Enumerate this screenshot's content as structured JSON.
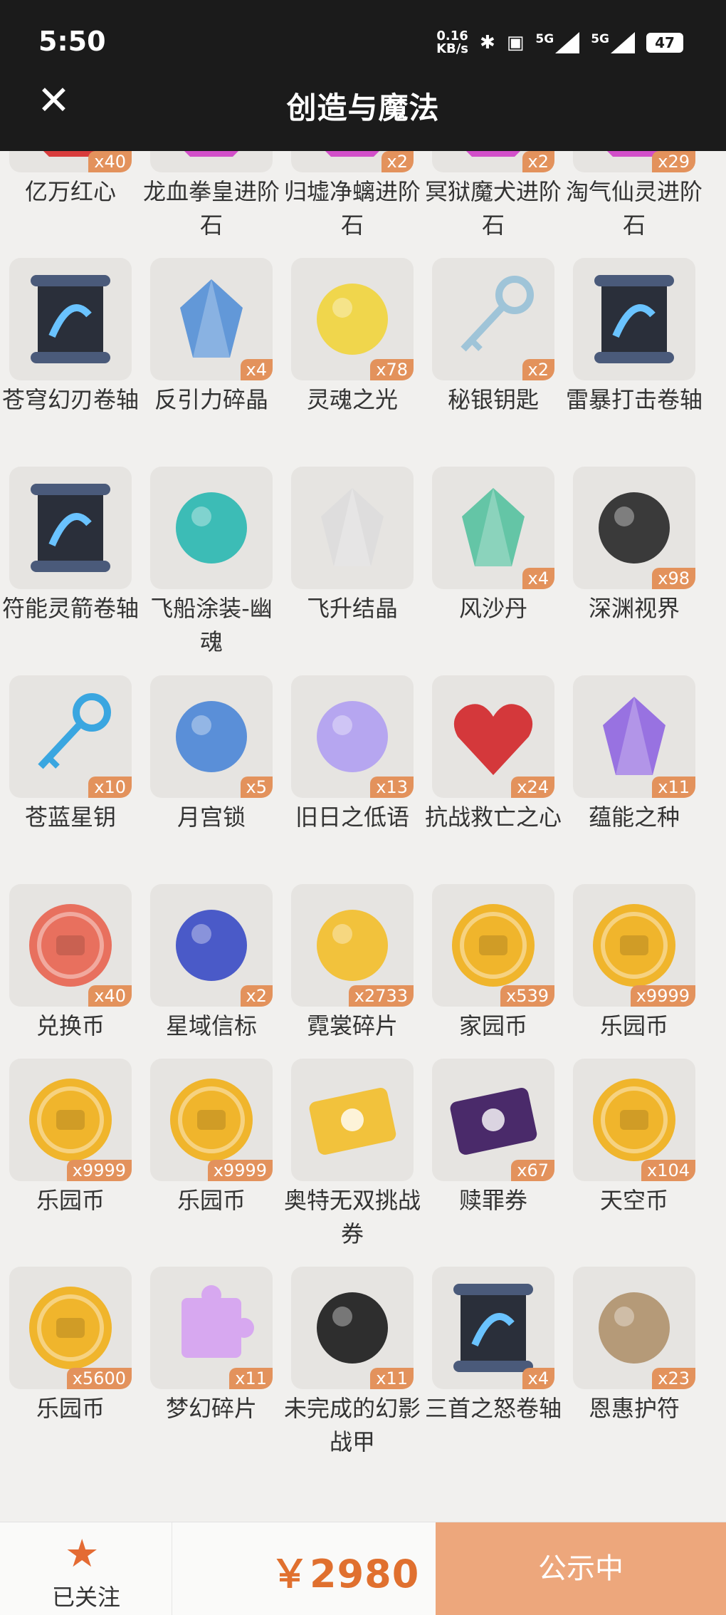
{
  "status_bar": {
    "time": "5:50",
    "speed_value": "0.16",
    "speed_unit": "KB/s",
    "network_1": "5G",
    "network_2": "5G",
    "battery": "47"
  },
  "header": {
    "title": "创造与魔法",
    "close_icon": "close-icon"
  },
  "items": [
    {
      "name": "亿万红心",
      "count": "x40",
      "icon": "heart-gem-icon",
      "color": "#d83c3c"
    },
    {
      "name": "龙血拳皇进阶石",
      "count": "",
      "icon": "bull-emblem-gem-icon",
      "color": "#d24fc9"
    },
    {
      "name": "归墟净螭进阶石",
      "count": "x2",
      "icon": "dragon-emblem-gem-icon",
      "color": "#d24fc9"
    },
    {
      "name": "冥狱魔犬进阶石",
      "count": "x2",
      "icon": "serpent-emblem-gem-icon",
      "color": "#d24fc9"
    },
    {
      "name": "淘气仙灵进阶石",
      "count": "x29",
      "icon": "fairy-emblem-gem-icon",
      "color": "#d24fc9"
    },
    {
      "name": "苍穹幻刃卷轴",
      "count": "",
      "icon": "scroll-icon",
      "color": "#2a2f3a"
    },
    {
      "name": "反引力碎晶",
      "count": "x4",
      "icon": "crystal-shards-icon",
      "color": "#4a8bd6"
    },
    {
      "name": "灵魂之光",
      "count": "x78",
      "icon": "soul-light-icon",
      "color": "#f0d64c"
    },
    {
      "name": "秘银钥匙",
      "count": "x2",
      "icon": "silver-key-icon",
      "color": "#9fc4d8"
    },
    {
      "name": "雷暴打击卷轴",
      "count": "",
      "icon": "scroll-icon",
      "color": "#2a2f3a"
    },
    {
      "name": "符能灵箭卷轴",
      "count": "",
      "icon": "scroll-icon",
      "color": "#2a2f3a"
    },
    {
      "name": "飞船涂装-幽魂",
      "count": "",
      "icon": "paint-spray-icon",
      "color": "#3cbcb6"
    },
    {
      "name": "飞升结晶",
      "count": "",
      "icon": "polyhedron-icon",
      "color": "#dcdcdc"
    },
    {
      "name": "风沙丹",
      "count": "x4",
      "icon": "crystal-ball-icon",
      "color": "#4cbf9b"
    },
    {
      "name": "深渊视界",
      "count": "x98",
      "icon": "abyss-sun-icon",
      "color": "#3a3a3a"
    },
    {
      "name": "苍蓝星钥",
      "count": "x10",
      "icon": "star-key-icon",
      "color": "#3aa6e0"
    },
    {
      "name": "月宫锁",
      "count": "x5",
      "icon": "moon-lock-icon",
      "color": "#5a8fd8"
    },
    {
      "name": "旧日之低语",
      "count": "x13",
      "icon": "whisper-orb-icon",
      "color": "#b6a6f0"
    },
    {
      "name": "抗战救亡之心",
      "count": "x24",
      "icon": "red-heart-icon",
      "color": "#d4383b"
    },
    {
      "name": "蕴能之种",
      "count": "x11",
      "icon": "purple-crystal-icon",
      "color": "#8a5ee0"
    },
    {
      "name": "兑换币",
      "count": "x40",
      "icon": "exchange-coin-icon",
      "color": "#e8705e"
    },
    {
      "name": "星域信标",
      "count": "x2",
      "icon": "beacon-icon",
      "color": "#4a5ac8"
    },
    {
      "name": "霓裳碎片",
      "count": "x2733",
      "icon": "clothing-shard-icon",
      "color": "#f2c23c"
    },
    {
      "name": "家园币",
      "count": "x539",
      "icon": "home-coin-icon",
      "color": "#f0b52c"
    },
    {
      "name": "乐园币",
      "count": "x9999",
      "icon": "chest-coin-icon",
      "color": "#f0b52c"
    },
    {
      "name": "乐园币",
      "count": "x9999",
      "icon": "chest-coin-icon",
      "color": "#f0b52c"
    },
    {
      "name": "乐园币",
      "count": "x9999",
      "icon": "chest-coin-icon",
      "color": "#f0b52c"
    },
    {
      "name": "奥特无双挑战券",
      "count": "",
      "icon": "challenge-ticket-icon",
      "color": "#f2c23c"
    },
    {
      "name": "赎罪券",
      "count": "x67",
      "icon": "redemption-ticket-icon",
      "color": "#4a2a6a"
    },
    {
      "name": "天空币",
      "count": "x104",
      "icon": "bow-coin-icon",
      "color": "#f0b52c"
    },
    {
      "name": "乐园币",
      "count": "x5600",
      "icon": "chest-coin-icon",
      "color": "#f0b52c"
    },
    {
      "name": "梦幻碎片",
      "count": "x11",
      "icon": "puzzle-piece-icon",
      "color": "#d7a8f0"
    },
    {
      "name": "未完成的幻影战甲",
      "count": "x11",
      "icon": "armor-stand-icon",
      "color": "#2e2e2e"
    },
    {
      "name": "三首之怒卷轴",
      "count": "x4",
      "icon": "scroll-icon",
      "color": "#2a2f3a"
    },
    {
      "name": "恩惠护符",
      "count": "x23",
      "icon": "stone-amulet-icon",
      "color": "#b59a78"
    }
  ],
  "footer": {
    "follow_label": "已关注",
    "star_icon": "star-icon",
    "price": "￥2980",
    "status_button": "公示中"
  }
}
